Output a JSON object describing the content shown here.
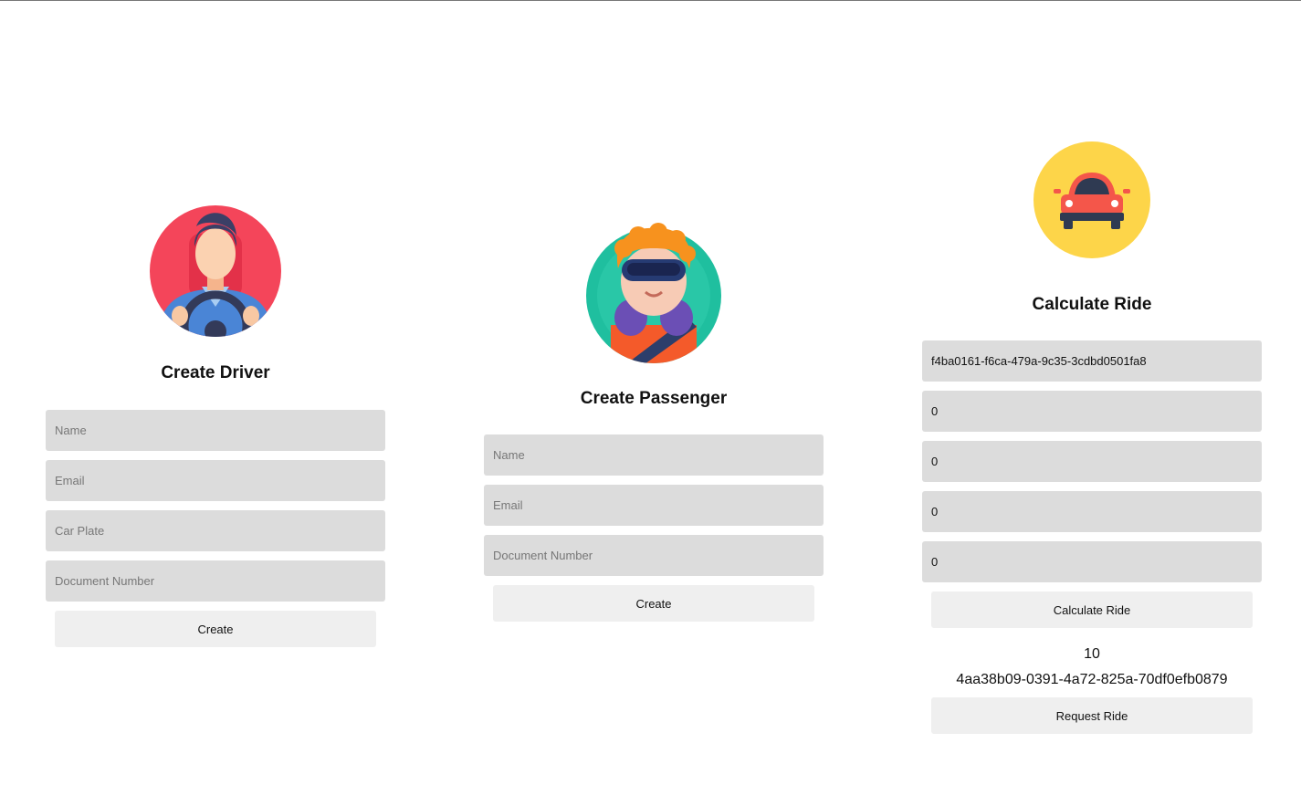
{
  "driver": {
    "title": "Create Driver",
    "avatar_icon": "driver-avatar-icon",
    "name_placeholder": "Name",
    "email_placeholder": "Email",
    "car_plate_placeholder": "Car Plate",
    "document_placeholder": "Document Number",
    "create_label": "Create"
  },
  "passenger": {
    "title": "Create Passenger",
    "avatar_icon": "passenger-avatar-icon",
    "name_placeholder": "Name",
    "email_placeholder": "Email",
    "document_placeholder": "Document Number",
    "create_label": "Create"
  },
  "ride": {
    "title": "Calculate Ride",
    "avatar_icon": "car-icon",
    "fields": [
      "f4ba0161-f6ca-479a-9c35-3cdbd0501fa8",
      "0",
      "0",
      "0",
      "0"
    ],
    "calculate_label": "Calculate Ride",
    "price": "10",
    "ride_id": "4aa38b09-0391-4a72-825a-70df0efb0879",
    "request_label": "Request Ride"
  },
  "colors": {
    "field_bg": "#dcdcdc",
    "button_bg": "#efefef",
    "driver_bg": "#f4455a",
    "passenger_bg": "#1fbf9f",
    "car_bg": "#fdd549",
    "car_body": "#f4564a"
  }
}
